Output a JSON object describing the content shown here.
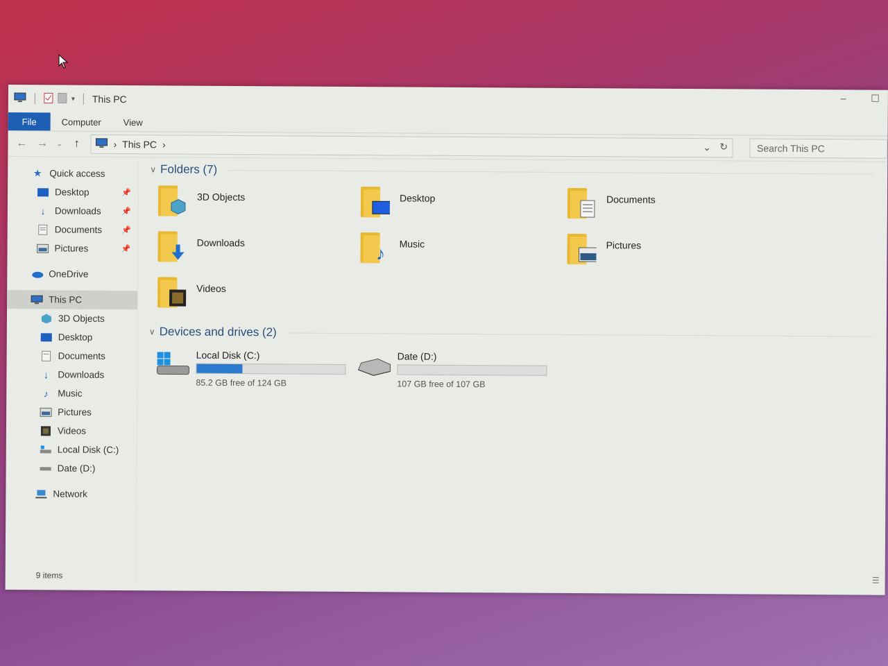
{
  "window": {
    "title": "This PC",
    "controls": {
      "minimize": "–",
      "maximize": "☐"
    }
  },
  "ribbon": {
    "tabs": [
      "File",
      "Computer",
      "View"
    ]
  },
  "address": {
    "path_root": "This PC",
    "separator": "›",
    "search_placeholder": "Search This PC"
  },
  "nav": {
    "quick_access": "Quick access",
    "quick_items": [
      {
        "label": "Desktop",
        "icon": "desktop-icon"
      },
      {
        "label": "Downloads",
        "icon": "download-icon"
      },
      {
        "label": "Documents",
        "icon": "document-icon"
      },
      {
        "label": "Pictures",
        "icon": "picture-icon"
      }
    ],
    "onedrive": "OneDrive",
    "this_pc": "This PC",
    "pc_items": [
      {
        "label": "3D Objects",
        "icon": "3d-objects-icon"
      },
      {
        "label": "Desktop",
        "icon": "desktop-icon"
      },
      {
        "label": "Documents",
        "icon": "document-icon"
      },
      {
        "label": "Downloads",
        "icon": "download-icon"
      },
      {
        "label": "Music",
        "icon": "music-icon"
      },
      {
        "label": "Pictures",
        "icon": "picture-icon"
      },
      {
        "label": "Videos",
        "icon": "video-icon"
      },
      {
        "label": "Local Disk (C:)",
        "icon": "local-disk-icon"
      },
      {
        "label": "Date (D:)",
        "icon": "drive-icon"
      }
    ],
    "network": "Network"
  },
  "content": {
    "folders_header": "Folders (7)",
    "folders": [
      {
        "label": "3D Objects",
        "icon": "3d-objects-icon"
      },
      {
        "label": "Desktop",
        "icon": "desktop-icon"
      },
      {
        "label": "Documents",
        "icon": "document-icon"
      },
      {
        "label": "Downloads",
        "icon": "download-icon"
      },
      {
        "label": "Music",
        "icon": "music-icon"
      },
      {
        "label": "Pictures",
        "icon": "picture-icon"
      },
      {
        "label": "Videos",
        "icon": "video-icon"
      }
    ],
    "drives_header": "Devices and drives (2)",
    "drives": [
      {
        "label": "Local Disk (C:)",
        "free_text": "85.2 GB free of 124 GB",
        "used_fraction": 0.31,
        "icon": "windows-drive-icon"
      },
      {
        "label": "Date (D:)",
        "free_text": "107 GB free of 107 GB",
        "used_fraction": 0.0,
        "icon": "drive-icon"
      }
    ]
  },
  "status": {
    "items": "9 items"
  },
  "colors": {
    "accent": "#1e5fb3",
    "bar_fill": "#2a7ad0",
    "folder": "#f2c94c"
  }
}
